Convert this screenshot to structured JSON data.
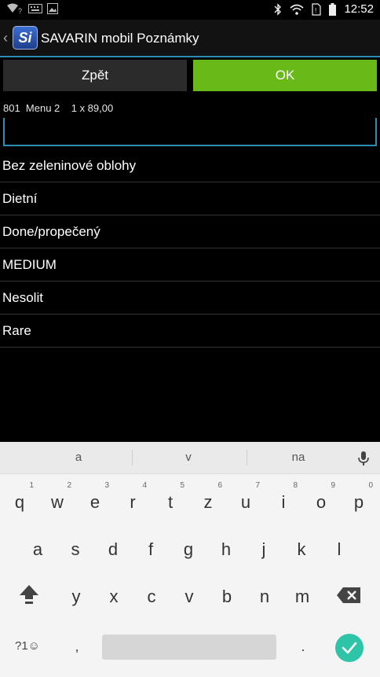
{
  "status_bar": {
    "time": "12:52",
    "left_icons": [
      "wifi-question-icon",
      "keyboard-icon",
      "image-icon"
    ],
    "right_icons": [
      "bluetooth-icon",
      "wifi-icon",
      "sim-icon",
      "battery-icon"
    ]
  },
  "action_bar": {
    "logo_text": "Si",
    "title": "SAVARIN mobil Poznámky"
  },
  "buttons": {
    "back_label": "Zpět",
    "ok_label": "OK"
  },
  "colors": {
    "accent": "#2f8db3",
    "ok_button": "#69b919",
    "background": "#000000",
    "enter_key": "#2ec4a8"
  },
  "item_info": "801  Menu 2    1 x 89,00",
  "note_input": {
    "value": "",
    "placeholder": ""
  },
  "notes": [
    "Bez zeleninové oblohy",
    "Dietní",
    "Done/propečený",
    "MEDIUM",
    "Nesolit",
    "Rare"
  ],
  "keyboard": {
    "suggestions": [
      "a",
      "v",
      "na"
    ],
    "row1": [
      {
        "key": "q",
        "hint": "1"
      },
      {
        "key": "w",
        "hint": "2"
      },
      {
        "key": "e",
        "hint": "3"
      },
      {
        "key": "r",
        "hint": "4"
      },
      {
        "key": "t",
        "hint": "5"
      },
      {
        "key": "z",
        "hint": "6"
      },
      {
        "key": "u",
        "hint": "7"
      },
      {
        "key": "i",
        "hint": "8"
      },
      {
        "key": "o",
        "hint": "9"
      },
      {
        "key": "p",
        "hint": "0"
      }
    ],
    "row2": [
      "a",
      "s",
      "d",
      "f",
      "g",
      "h",
      "j",
      "k",
      "l"
    ],
    "row3": [
      "y",
      "x",
      "c",
      "v",
      "b",
      "n",
      "m"
    ],
    "symbols_label": "?1☺",
    "comma": ",",
    "period": "."
  }
}
